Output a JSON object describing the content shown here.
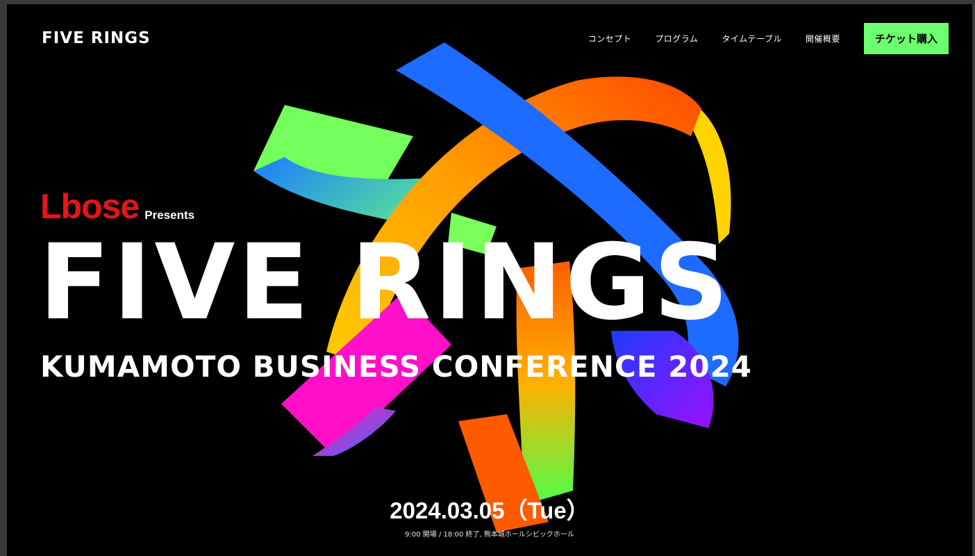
{
  "site": {
    "logo": "FIVE RINGS"
  },
  "nav": {
    "items": [
      {
        "label": "コンセプト"
      },
      {
        "label": "プログラム"
      },
      {
        "label": "タイムテーブル"
      },
      {
        "label": "開催概要"
      }
    ],
    "ticket_label": "チケット購入",
    "ticket_color": "#6dff6d"
  },
  "hero": {
    "sponsor": "Lbose",
    "sponsor_color": "#e8141c",
    "presents": "Presents",
    "title": "FIVE RINGS",
    "subtitle": "KUMAMOTO BUSINESS CONFERENCE 2024",
    "date": "2024.03.05（Tue）",
    "details": "9:00 開場 / 18:00 終了, 熊本城ホールシビックホール"
  },
  "artwork": {
    "description_colors": [
      "#7bff5a",
      "#1e6bff",
      "#ff6a00",
      "#ffd400",
      "#ff10c8",
      "#7a2cff"
    ]
  }
}
